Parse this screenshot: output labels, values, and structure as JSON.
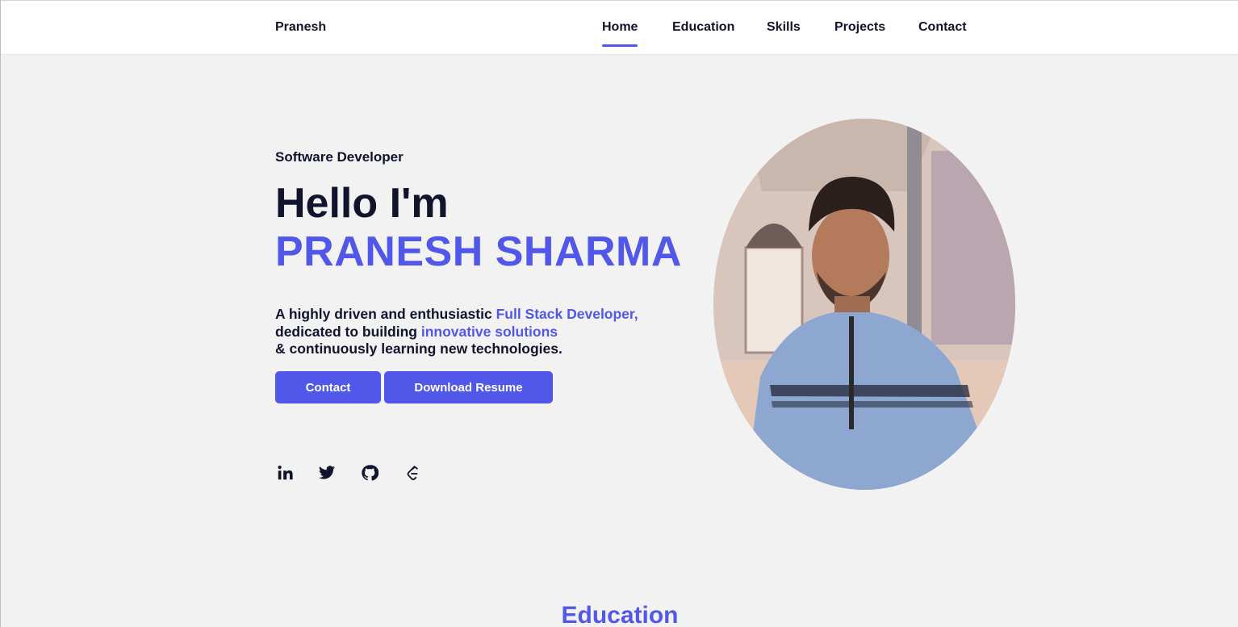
{
  "nav": {
    "brand": "Pranesh",
    "links": [
      {
        "label": "Home",
        "active": true
      },
      {
        "label": "Education",
        "active": false
      },
      {
        "label": "Skills",
        "active": false
      },
      {
        "label": "Projects",
        "active": false
      },
      {
        "label": "Contact",
        "active": false
      }
    ]
  },
  "hero": {
    "subtitle": "Software Developer",
    "greeting": "Hello I'm",
    "name": "PRANESH SHARMA",
    "desc_line1_a": "A highly driven and enthusiastic ",
    "desc_line1_b": "Full Stack Developer,",
    "desc_line2_a": "dedicated to building ",
    "desc_line2_b": "innovative solutions",
    "desc_line3": "& continuously learning new technologies.",
    "contact_button": "Contact",
    "resume_button": "Download Resume",
    "socials": [
      "linkedin-icon",
      "twitter-icon",
      "github-icon",
      "leetcode-icon"
    ]
  },
  "education": {
    "title": "Education"
  },
  "colors": {
    "accent": "#5157e8",
    "text": "#11142d",
    "background": "#f3f2f3"
  }
}
